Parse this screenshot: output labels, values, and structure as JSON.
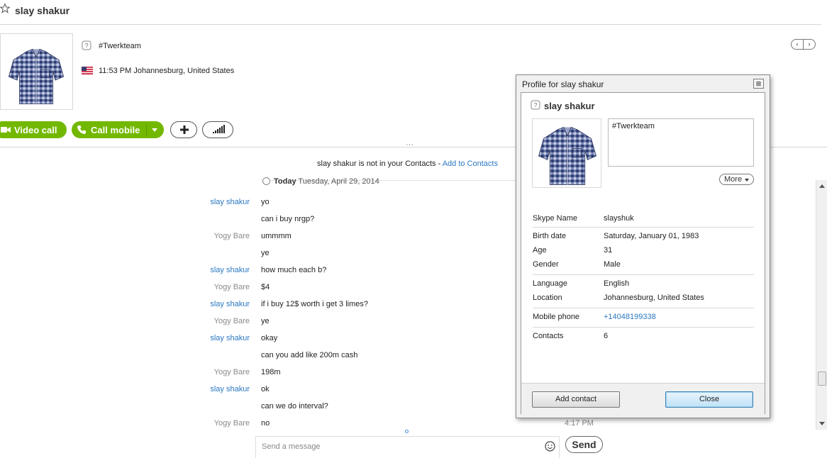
{
  "header": {
    "contact_name": "slay shakur",
    "mood": "#Twerkteam",
    "local_time_location": "11:53 PM Johannesburg, United States"
  },
  "actions": {
    "video_call_label": "Video call",
    "call_mobile_label": "Call mobile",
    "add_symbol": "+"
  },
  "notice": {
    "text": "slay shakur is not in your Contacts - ",
    "link": "Add to Contacts"
  },
  "conversation": {
    "date_bold": "Today",
    "date_rest": " Tuesday, April 29, 2014",
    "messages": [
      {
        "sender": "slay shakur",
        "text": "yo"
      },
      {
        "sender": "",
        "text": "can i buy nrgp?"
      },
      {
        "sender": "Yogy Bare",
        "text": "ummmm"
      },
      {
        "sender": "",
        "text": "ye"
      },
      {
        "sender": "slay shakur",
        "text": "how much each b?"
      },
      {
        "sender": "Yogy Bare",
        "text": "$4"
      },
      {
        "sender": "slay shakur",
        "text": "if i buy 12$ worth i get 3 limes?"
      },
      {
        "sender": "Yogy Bare",
        "text": "ye"
      },
      {
        "sender": "slay shakur",
        "text": "okay"
      },
      {
        "sender": "",
        "text": "can you add like 200m cash"
      },
      {
        "sender": "Yogy Bare",
        "text": "198m"
      },
      {
        "sender": "slay shakur",
        "text": "ok"
      },
      {
        "sender": "",
        "text": "can we do interval?"
      },
      {
        "sender": "Yogy Bare",
        "text": "no"
      }
    ],
    "last_time": "4:17 PM"
  },
  "compose": {
    "placeholder": "Send a message",
    "send_label": "Send"
  },
  "profile_dialog": {
    "title": "Profile for slay shakur",
    "close_x": "⊠",
    "name": "slay shakur",
    "mood": "#Twerkteam",
    "more_label": "More",
    "fields": {
      "skype_name_label": "Skype Name",
      "skype_name": "slayshuk",
      "birth_label": "Birth date",
      "birth": "Saturday, January 01, 1983",
      "age_label": "Age",
      "age": "31",
      "gender_label": "Gender",
      "gender": "Male",
      "language_label": "Language",
      "language": "English",
      "location_label": "Location",
      "location": "Johannesburg, United States",
      "mobile_label": "Mobile phone",
      "mobile": "+14048199338",
      "contacts_label": "Contacts",
      "contacts": "6"
    },
    "add_contact_label": "Add contact",
    "close_label": "Close"
  },
  "colors": {
    "accent_green": "#73b800",
    "link_blue": "#2a78c2",
    "shirt_blue": "#3a4f8c"
  }
}
